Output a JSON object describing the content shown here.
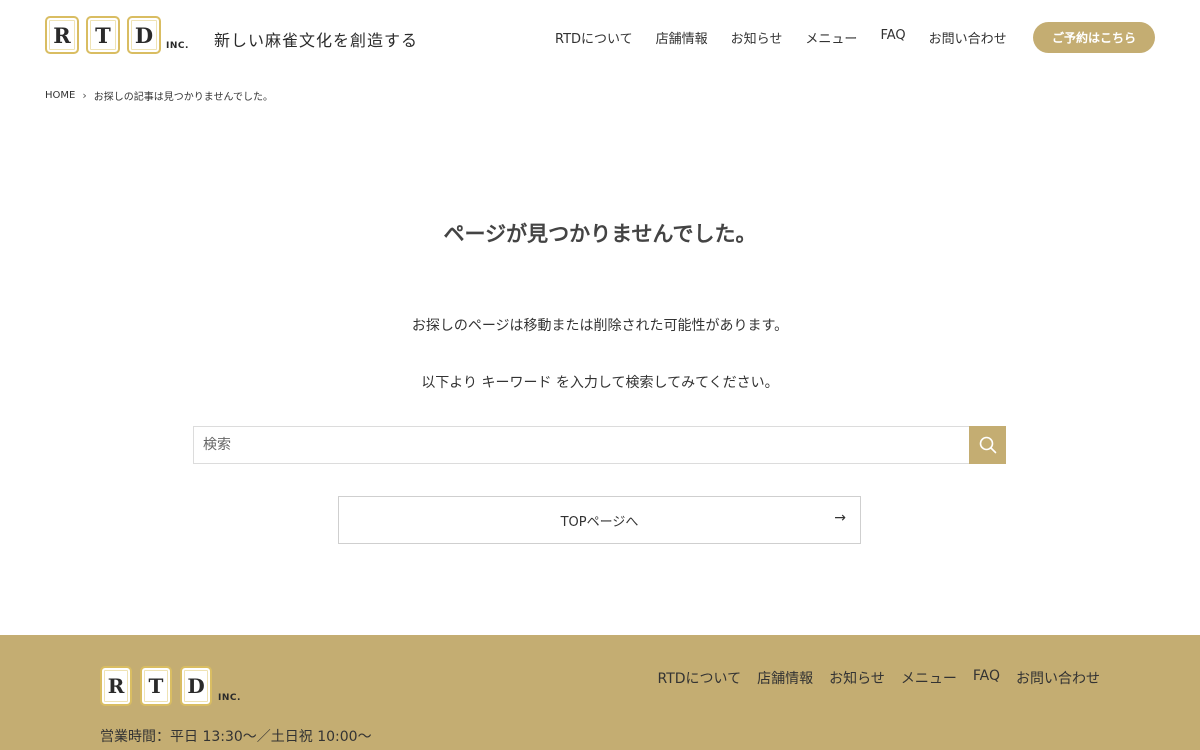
{
  "header": {
    "logo_letters": [
      "R",
      "T",
      "D"
    ],
    "logo_suffix": "INC.",
    "tagline": "新しい麻雀文化を創造する",
    "nav": [
      "RTDについて",
      "店舗情報",
      "お知らせ",
      "メニュー",
      "FAQ",
      "お問い合わせ"
    ],
    "reserve_label": "ご予約はこちら"
  },
  "breadcrumb": {
    "home": "HOME",
    "separator": "›",
    "current": "お探しの記事は見つかりませんでした。"
  },
  "main": {
    "title": "ページが見つかりませんでした。",
    "message1": "お探しのページは移動または削除された可能性があります。",
    "message2": "以下より キーワード を入力して検索してみてください。",
    "search_placeholder": "検索",
    "top_button": "TOPページへ",
    "top_arrow": "→"
  },
  "footer": {
    "logo_letters": [
      "R",
      "T",
      "D"
    ],
    "logo_suffix": "INC.",
    "nav": [
      "RTDについて",
      "店舗情報",
      "お知らせ",
      "メニュー",
      "FAQ",
      "お問い合わせ"
    ],
    "hours": "営業時間：平日 13:30〜／土日祝 10:00〜"
  },
  "colors": {
    "accent": "#c4ad72",
    "tile_border": "#d9bd62"
  },
  "icons": {
    "search": "search-icon",
    "breadcrumb_separator": "chevron-right-icon"
  }
}
